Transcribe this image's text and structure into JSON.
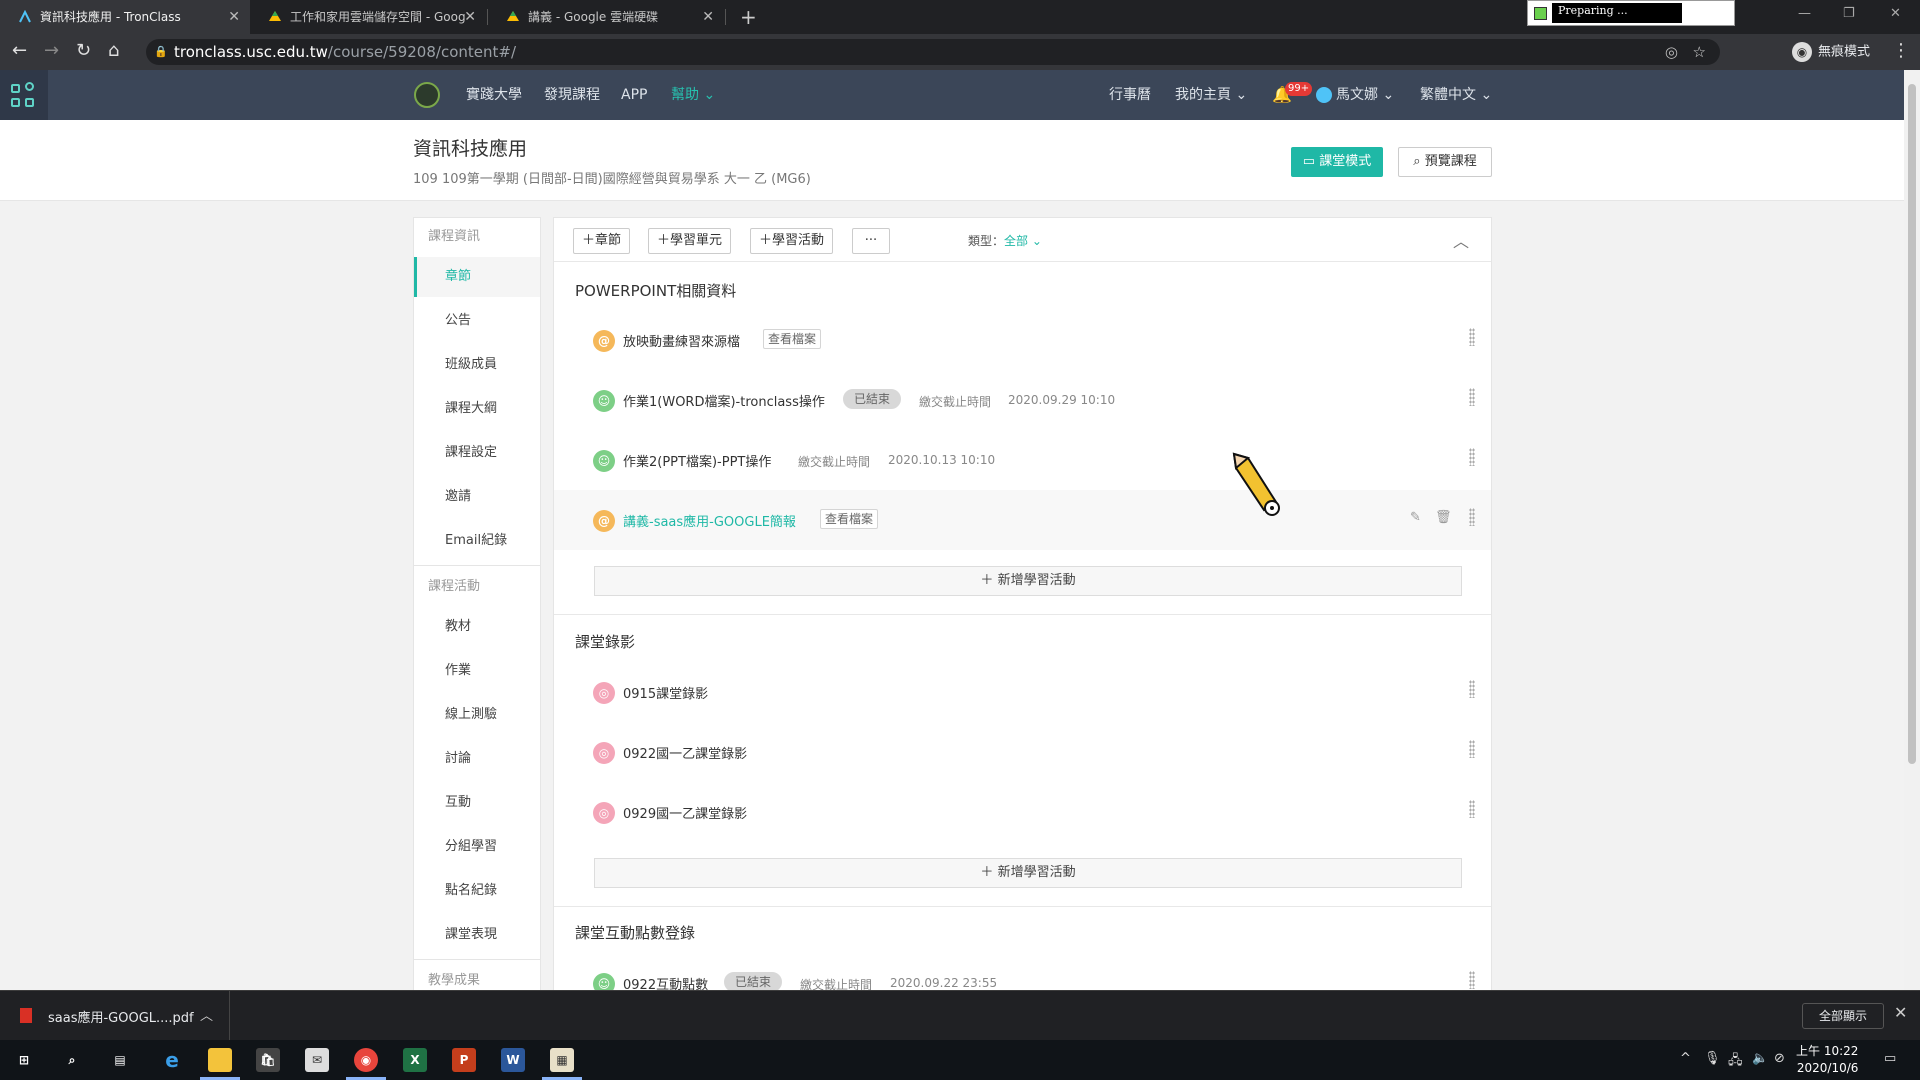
{
  "browser": {
    "tabs": [
      {
        "title": "資訊科技應用 - TronClass",
        "active": true
      },
      {
        "title": "工作和家用雲端儲存空間 - Goog",
        "active": false
      },
      {
        "title": "講義 - Google 雲端硬碟",
        "active": false
      }
    ],
    "tab_close": "✕",
    "new_tab": "+",
    "preparing": "Preparing ...",
    "window_controls": [
      "—",
      "❐",
      "✕"
    ],
    "url_host": "tronclass.usc.edu.tw",
    "url_path": "/course/59208/content#/",
    "incognito_label": "無痕模式"
  },
  "app": {
    "nav": [
      "實踐大學",
      "發現課程",
      "APP"
    ],
    "help": "幫助",
    "right_nav": [
      "行事曆",
      "我的主頁"
    ],
    "notification_count": "99+",
    "user": "馬文娜",
    "language": "繁體中文"
  },
  "course": {
    "title": "資訊科技應用",
    "subtitle": "109 109第一學期 (日間部-日間)國際經營與貿易學系 大一 乙 (MG6)",
    "class_mode": "課堂模式",
    "preview": "預覽課程"
  },
  "sidebar": {
    "group1": "課程資訊",
    "items1": [
      "章節",
      "公告",
      "班級成員",
      "課程大綱",
      "課程設定",
      "邀請",
      "Email紀錄"
    ],
    "group2": "課程活動",
    "items2": [
      "教材",
      "作業",
      "線上測驗",
      "討論",
      "互動",
      "分組學習",
      "點名紀錄",
      "課堂表現"
    ],
    "group3": "教學成果"
  },
  "toolbar": {
    "add_chapter": "章節",
    "add_unit": "學習單元",
    "add_activity": "學習活動",
    "more": "···",
    "type_label": "類型：",
    "type_value": "全部"
  },
  "sections": [
    {
      "title": "POWERPOINT相關資料",
      "activities": [
        {
          "name": "放映動畫練習來源檔",
          "tag": "查看檔案",
          "icon_color": "#f5b85a"
        },
        {
          "name": "作業1(WORD檔案)-tronclass操作",
          "tag": "已結束",
          "deadline_label": "繳交截止時間",
          "deadline": "2020.09.29 10:10",
          "icon_color": "#7dcf86"
        },
        {
          "name": "作業2(PPT檔案)-PPT操作",
          "deadline_label": "繳交截止時間",
          "deadline": "2020.10.13 10:10",
          "icon_color": "#7dcf86"
        },
        {
          "name": "講義-saas應用-GOOGLE簡報",
          "tag": "查看檔案",
          "icon_color": "#f5b85a"
        }
      ],
      "add_label": "新增學習活動"
    },
    {
      "title": "課堂錄影",
      "activities": [
        {
          "name": "0915課堂錄影",
          "icon_color": "#f4a5b8"
        },
        {
          "name": "0922國一乙課堂錄影",
          "icon_color": "#f4a5b8"
        },
        {
          "name": "0929國一乙課堂錄影",
          "icon_color": "#f4a5b8"
        }
      ],
      "add_label": "新增學習活動"
    },
    {
      "title": "課堂互動點數登錄",
      "activities": [
        {
          "name": "0922互動點數",
          "tag": "已結束",
          "deadline_label": "繳交截止時間",
          "deadline": "2020.09.22 23:55",
          "icon_color": "#7dcf86"
        }
      ]
    }
  ],
  "downloads": {
    "file": "saas應用-GOOGL....pdf",
    "show_all": "全部顯示"
  },
  "taskbar": {
    "time": "上午 10:22",
    "date": "2020/10/6"
  },
  "colors": {
    "accent": "#1fb8a6",
    "header": "#3b4658"
  }
}
